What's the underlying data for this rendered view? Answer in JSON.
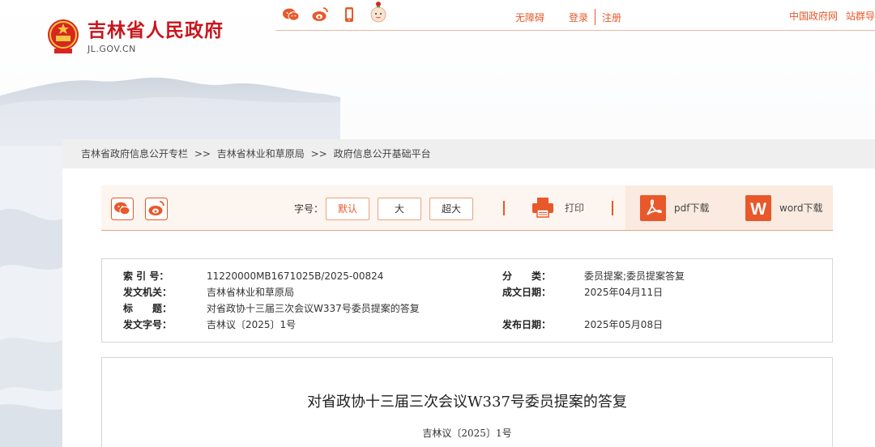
{
  "header": {
    "site_name": "吉林省人民政府",
    "site_domain": "JL.GOV.CN",
    "icons": [
      "wechat-icon",
      "weibo-icon",
      "mobile-icon",
      "mascot-icon"
    ],
    "links": {
      "accessibility": "无障碍",
      "login": "登录",
      "register": "注册"
    },
    "right_links": [
      "中国政府网",
      "站群导"
    ]
  },
  "breadcrumb": {
    "items": [
      "吉林省政府信息公开专栏",
      "吉林省林业和草原局",
      "政府信息公开基础平台"
    ],
    "separator": ">>"
  },
  "toolbar": {
    "font_label": "字号：",
    "font_sizes": [
      "默认",
      "大",
      "超大"
    ],
    "print_label": "打印",
    "pdf_label": "pdf下载",
    "word_label": "word下载",
    "accent_color": "#e8582a"
  },
  "meta": {
    "index_key": "索 引 号：",
    "index_val": "11220000MB1671025B/2025-00824",
    "category_key": "分　　类：",
    "category_val": "委员提案;委员提案答复",
    "issuer_key": "发文机关：",
    "issuer_val": "吉林省林业和草原局",
    "created_key": "成文日期：",
    "created_val": "2025年04月11日",
    "title_key": "标　　题：",
    "title_val": "对省政协十三届三次会议W337号委员提案的答复",
    "docno_key": "发文字号：",
    "docno_val": "吉林议〔2025〕1号",
    "published_key": "发布日期：",
    "published_val": "2025年05月08日"
  },
  "article": {
    "title": "对省政协十三届三次会议W337号委员提案的答复",
    "doc_number": "吉林议〔2025〕1号"
  }
}
